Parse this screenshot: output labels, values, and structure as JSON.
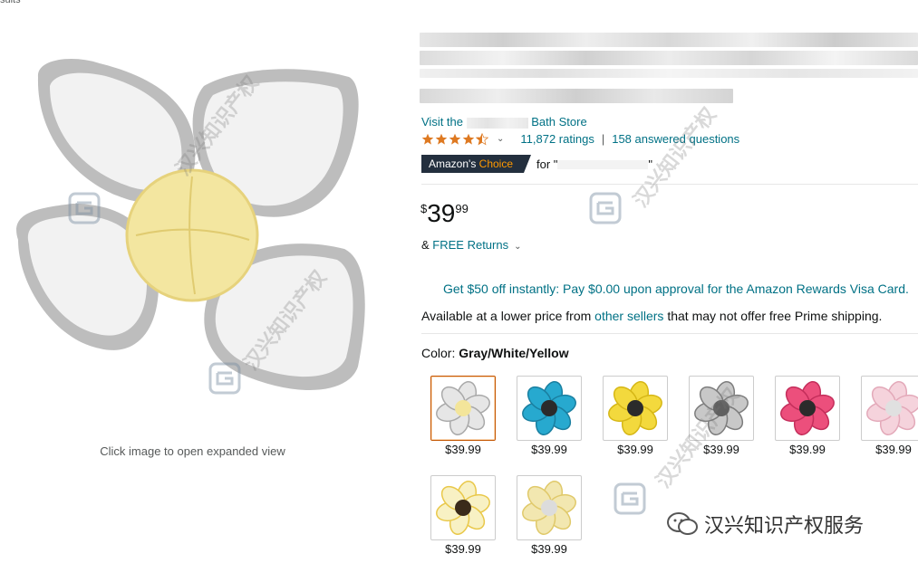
{
  "breadcrumb": "sults",
  "image_caption": "Click image to open expanded view",
  "store": {
    "prefix": "Visit the",
    "suffix": "Bath Store"
  },
  "rating": {
    "stars": 4.5,
    "count_text": "11,872 ratings",
    "separator": "|",
    "answered_text": "158 answered questions"
  },
  "choice": {
    "brand": "Amazon's",
    "highlight": "Choice",
    "for_prefix": "for \"",
    "for_suffix": "\""
  },
  "price": {
    "symbol": "$",
    "whole": "39",
    "fraction": "99"
  },
  "returns": {
    "prefix": "& ",
    "link": "FREE Returns"
  },
  "promo": "Get $50 off instantly: Pay $0.00 upon approval for the Amazon Rewards Visa Card.",
  "availability": {
    "before": "Available at a lower price from ",
    "link": "other sellers",
    "after": " that may not offer free Prime shipping."
  },
  "color": {
    "label": "Color: ",
    "selected": "Gray/White/Yellow"
  },
  "swatches": [
    {
      "price": "$39.99",
      "petal": "#e6e6e6",
      "edge": "#a9a9a9",
      "center": "#f3e59a",
      "selected": true
    },
    {
      "price": "$39.99",
      "petal": "#27a9cf",
      "edge": "#1a7fa0",
      "center": "#2b2b2b",
      "selected": false
    },
    {
      "price": "$39.99",
      "petal": "#f3d93d",
      "edge": "#d6b716",
      "center": "#2b2b2b",
      "selected": false
    },
    {
      "price": "$39.99",
      "petal": "#c8c8c8",
      "edge": "#7d7d7d",
      "center": "#606060",
      "selected": false
    },
    {
      "price": "$39.99",
      "petal": "#ec4f7c",
      "edge": "#c42e5b",
      "center": "#2b2b2b",
      "selected": false
    },
    {
      "price": "$39.99",
      "petal": "#f5d3dc",
      "edge": "#e3a9b9",
      "center": "#e0e0e0",
      "selected": false
    },
    {
      "price": "$39.99",
      "petal": "#f8f1c4",
      "edge": "#e9c84a",
      "center": "#3a2a1a",
      "selected": false
    },
    {
      "price": "$39.99",
      "petal": "#f2e7b0",
      "edge": "#e0c96a",
      "center": "#dcdcdc",
      "selected": false
    }
  ],
  "watermark": {
    "logo_text": "汉兴知识产权",
    "footer": "汉兴知识产权服务"
  },
  "colors": {
    "link": "#007185",
    "badge_bg": "#232f3e",
    "badge_accent": "#ff9900",
    "selected_border": "#c45500"
  }
}
